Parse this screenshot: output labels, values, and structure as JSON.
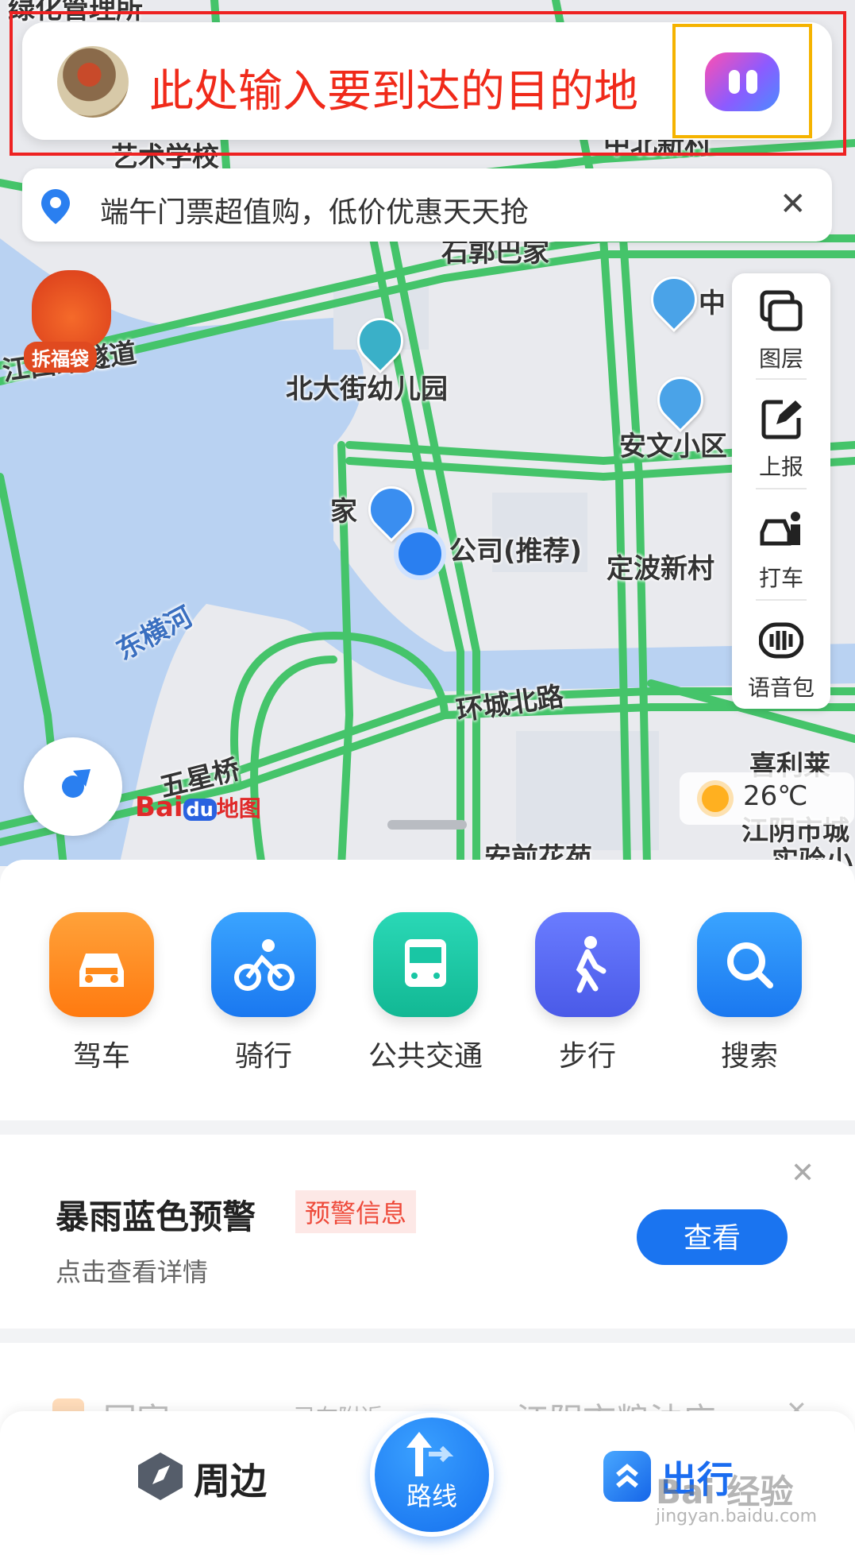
{
  "search": {
    "placeholder_text": "此处输入要到达的目的地"
  },
  "promo": {
    "text": "端午门票超值购，低价优惠天天抢",
    "close": "✕"
  },
  "map": {
    "labels": {
      "tunnel": "江西路隧道",
      "kindergarten": "北大街幼儿园",
      "anwen": "安文小区",
      "home": "家",
      "company": "公司(推荐)",
      "dingbo": "定波新村",
      "river": "东横河",
      "huancheng": "环城北路",
      "wuxingqiao": "五星桥",
      "xili": "喜利莱",
      "jiangyin": "江阴市城",
      "zhong": "中",
      "fudai": "拆福袋",
      "top_left": "绿化管理所",
      "arts_school": "艺术学校",
      "top_right": "中北新村",
      "shidao": "石郭巴家",
      "bottom_street": "安前花苑",
      "shiyan": "实验小"
    },
    "logo": {
      "bai": "Bai",
      "du": "du",
      "suffix": "地图"
    }
  },
  "toolbar": {
    "items": [
      {
        "label": "图层",
        "icon": "layers-icon"
      },
      {
        "label": "上报",
        "icon": "report-edit-icon"
      },
      {
        "label": "打车",
        "icon": "taxi-icon"
      },
      {
        "label": "语音包",
        "icon": "voice-pack-icon"
      }
    ]
  },
  "weather": {
    "temp": "26℃"
  },
  "modes": [
    {
      "label": "驾车",
      "color": "#ff8a1a"
    },
    {
      "label": "骑行",
      "color": "#2a8cf5"
    },
    {
      "label": "公共交通",
      "color": "#19c6a4"
    },
    {
      "label": "步行",
      "color": "#5b6cf2"
    },
    {
      "label": "搜索",
      "color": "#2a8cf5"
    }
  ],
  "warning": {
    "title": "暴雨蓝色预警",
    "tag": "预警信息",
    "subtitle": "点击查看详情",
    "button": "查看",
    "close": "✕"
  },
  "favorites": {
    "home": "回家",
    "commute": "已在附近",
    "place": "江阴市粮油应...",
    "close": "✕"
  },
  "bottomnav": {
    "nearby": "周边",
    "route": "路线",
    "trip": "出行"
  },
  "watermark": {
    "main": "Bai 经验",
    "sub": "jingyan.baidu.com"
  }
}
